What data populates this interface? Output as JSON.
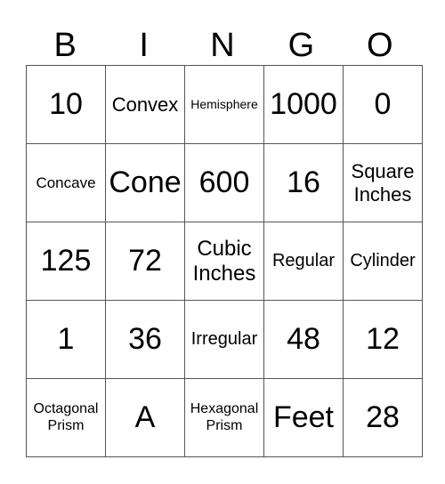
{
  "header": [
    "B",
    "I",
    "N",
    "G",
    "O"
  ],
  "rows": [
    [
      "10",
      "Convex",
      "Hemisphere",
      "1000",
      "0"
    ],
    [
      "Concave",
      "Cone",
      "600",
      "16",
      "Square Inches"
    ],
    [
      "125",
      "72",
      "Cubic Inches",
      "Regular",
      "Cylinder"
    ],
    [
      "1",
      "36",
      "Irregular",
      "48",
      "12"
    ],
    [
      "Octagonal Prism",
      "A",
      "Hexagonal Prism",
      "Feet",
      "28"
    ]
  ]
}
